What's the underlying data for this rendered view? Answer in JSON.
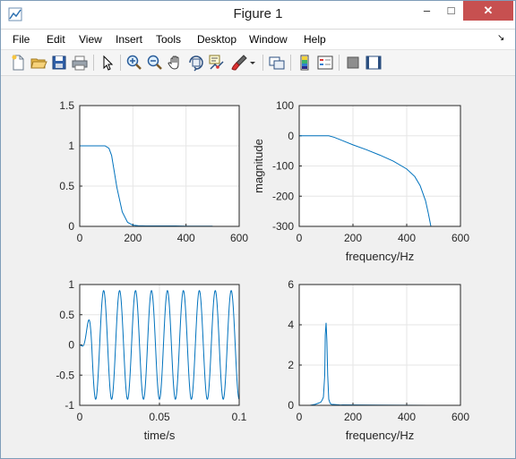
{
  "window": {
    "title": "Figure 1",
    "controls": {
      "minimize": "–",
      "maximize": "□",
      "close": "✕"
    }
  },
  "menu": {
    "items": [
      "File",
      "Edit",
      "View",
      "Insert",
      "Tools",
      "Desktop",
      "Window",
      "Help"
    ],
    "right_arrow": "↘"
  },
  "toolbar": {
    "icons": [
      "new-figure-icon",
      "open-file-icon",
      "save-icon",
      "print-icon",
      "pointer-icon",
      "zoom-in-icon",
      "zoom-out-icon",
      "pan-hand-icon",
      "rotate-3d-icon",
      "data-cursor-icon",
      "brush-icon",
      "brush-dropdown-icon",
      "link-plot-icon",
      "colorbar-icon",
      "legend-icon",
      "hide-plot-tools-icon",
      "show-plot-tools-icon"
    ]
  },
  "colors": {
    "line": "#0072bd",
    "axes_bg": "#ffffff",
    "grid": "#e6e6e6",
    "axis": "#262626"
  },
  "chart_data": [
    {
      "type": "line",
      "title": "",
      "xlabel": "",
      "ylabel": "",
      "xlim": [
        0,
        600
      ],
      "ylim": [
        0,
        1.5
      ],
      "xticks": [
        "0",
        "200",
        "400",
        "600"
      ],
      "yticks": [
        "0",
        "0.5",
        "1",
        "1.5"
      ],
      "grid": true,
      "series": [
        {
          "x": [
            0,
            80,
            95,
            110,
            120,
            125,
            140,
            160,
            180,
            200,
            220,
            250,
            300,
            340,
            360,
            400,
            500
          ],
          "y": [
            1,
            1,
            1,
            0.97,
            0.88,
            0.78,
            0.48,
            0.18,
            0.05,
            0.015,
            0.008,
            0.005,
            0.005,
            0.005,
            0.005,
            0.003,
            0.003
          ]
        }
      ]
    },
    {
      "type": "line",
      "title": "",
      "xlabel": "frequency/Hz",
      "ylabel": "magnitude",
      "xlim": [
        0,
        600
      ],
      "ylim": [
        -300,
        100
      ],
      "xticks": [
        "0",
        "200",
        "400",
        "600"
      ],
      "yticks": [
        "-300",
        "-200",
        "-100",
        "0",
        "100"
      ],
      "grid": true,
      "series": [
        {
          "x": [
            0,
            110,
            130,
            150,
            200,
            250,
            300,
            350,
            400,
            430,
            450,
            470,
            480,
            490
          ],
          "y": [
            0,
            0,
            -5,
            -12,
            -30,
            -46,
            -64,
            -84,
            -110,
            -135,
            -165,
            -215,
            -255,
            -300
          ]
        }
      ]
    },
    {
      "type": "line",
      "title": "",
      "xlabel": "time/s",
      "ylabel": "",
      "xlim": [
        0,
        0.1
      ],
      "ylim": [
        -1,
        1
      ],
      "xticks": [
        "0",
        "0.05",
        "0.1"
      ],
      "yticks": [
        "-1",
        "-0.5",
        "0",
        "0.5",
        "1"
      ],
      "grid": true,
      "frequency_hz": 100,
      "amplitude": 0.9,
      "onset_s": 0.008
    },
    {
      "type": "line",
      "title": "",
      "xlabel": "frequency/Hz",
      "ylabel": "",
      "xlim": [
        0,
        600
      ],
      "ylim": [
        0,
        6
      ],
      "xticks": [
        "0",
        "200",
        "400",
        "600"
      ],
      "yticks": [
        "0",
        "2",
        "4",
        "6"
      ],
      "grid": true,
      "series": [
        {
          "x": [
            0,
            40,
            60,
            70,
            80,
            85,
            90,
            95,
            97,
            100,
            103,
            106,
            110,
            115,
            120,
            150,
            300,
            480
          ],
          "y": [
            0,
            0,
            0.05,
            0.1,
            0.15,
            0.25,
            0.4,
            1.5,
            3.5,
            4.1,
            3.2,
            1.5,
            0.3,
            0.1,
            0.05,
            0.02,
            0.01,
            0
          ]
        }
      ]
    }
  ]
}
